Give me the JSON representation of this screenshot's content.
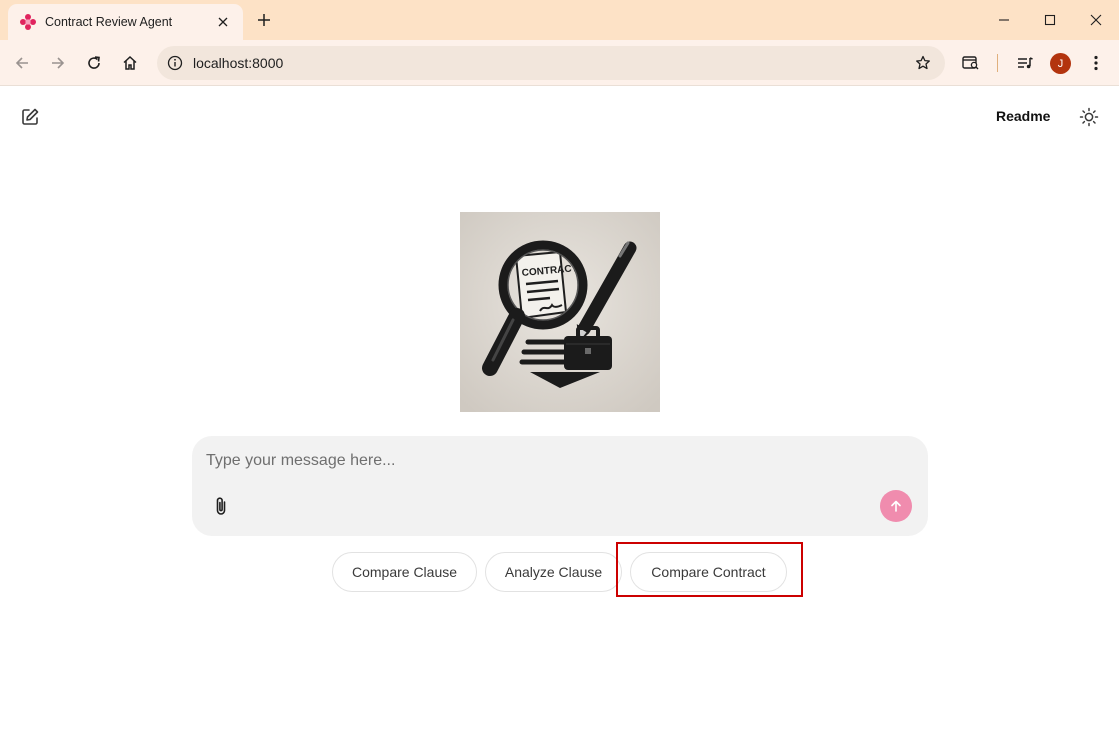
{
  "browser": {
    "tab": {
      "title": "Contract Review Agent",
      "favicon": "diamond-logo-icon"
    },
    "address_bar": {
      "url": "localhost:8000"
    },
    "profile_initial": "J",
    "colors": {
      "tabstrip": "#fde2c6",
      "toolbar": "#fdf1ea",
      "avatar": "#b3340e"
    }
  },
  "app": {
    "header": {
      "readme_label": "Readme"
    },
    "hero": {
      "image_text": "CONTRACT"
    },
    "composer": {
      "placeholder": "Type your message here..."
    },
    "suggestions": [
      {
        "label": "Compare Clause"
      },
      {
        "label": "Analyze Clause"
      },
      {
        "label": "Compare Contract"
      }
    ],
    "colors": {
      "send_button": "#f08cae",
      "composer_bg": "#f2f2f2",
      "highlight_box": "#cc0000"
    }
  }
}
